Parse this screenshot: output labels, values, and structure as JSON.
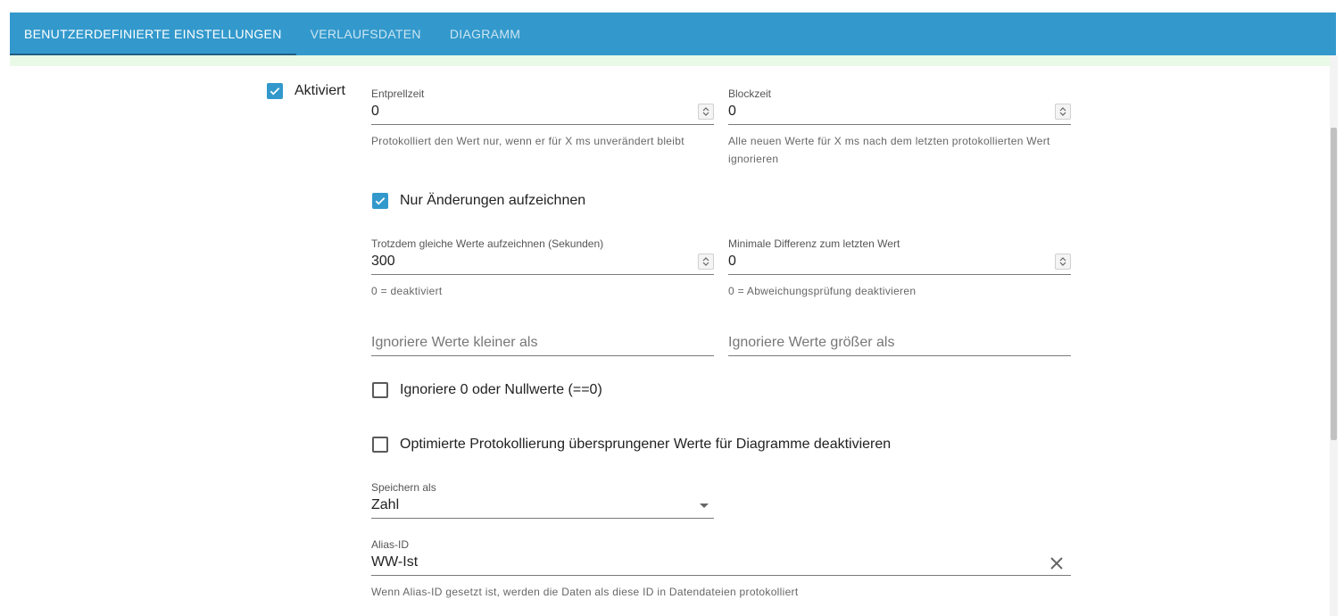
{
  "tabs": [
    {
      "label": "BENUTZERDEFINIERTE EINSTELLUNGEN",
      "active": true
    },
    {
      "label": "VERLAUFSDATEN",
      "active": false
    },
    {
      "label": "DIAGRAMM",
      "active": false
    }
  ],
  "colors": {
    "tabbar": "#3399cc",
    "checkbox_accent": "#3399cc",
    "strip": "#e9fbe7"
  },
  "enabled": {
    "label": "Aktiviert",
    "checked": true
  },
  "debounce": {
    "label": "Entprellzeit",
    "value": "0",
    "help": "Protokolliert den Wert nur, wenn er für X ms unverändert bleibt"
  },
  "blocktime": {
    "label": "Blockzeit",
    "value": "0",
    "help": "Alle neuen Werte für X ms nach dem letzten protokollierten Wert ignorieren"
  },
  "changes_only": {
    "label": "Nur Änderungen aufzeichnen",
    "checked": true
  },
  "change_interval": {
    "label": "Trotzdem gleiche Werte aufzeichnen (Sekunden)",
    "value": "300",
    "help": "0 = deaktiviert"
  },
  "min_diff": {
    "label": "Minimale Differenz zum letzten Wert",
    "value": "0",
    "help": "0 = Abweichungsprüfung deaktivieren"
  },
  "ignore_below": {
    "placeholder": "Ignoriere Werte kleiner als",
    "value": ""
  },
  "ignore_above": {
    "placeholder": "Ignoriere Werte größer als",
    "value": ""
  },
  "ignore_zero": {
    "label": "Ignoriere 0 oder Nullwerte (==0)",
    "checked": false
  },
  "disable_skipped": {
    "label": "Optimierte Protokollierung übersprungener Werte für Diagramme deaktivieren",
    "checked": false
  },
  "storage_type": {
    "label": "Speichern als",
    "value": "Zahl",
    "icon": "chevron-down-icon"
  },
  "alias_id": {
    "label": "Alias-ID",
    "value": "WW-Ist",
    "help": "Wenn Alias-ID gesetzt ist, werden die Daten als diese ID in Datendateien protokolliert",
    "icon": "close-icon"
  }
}
